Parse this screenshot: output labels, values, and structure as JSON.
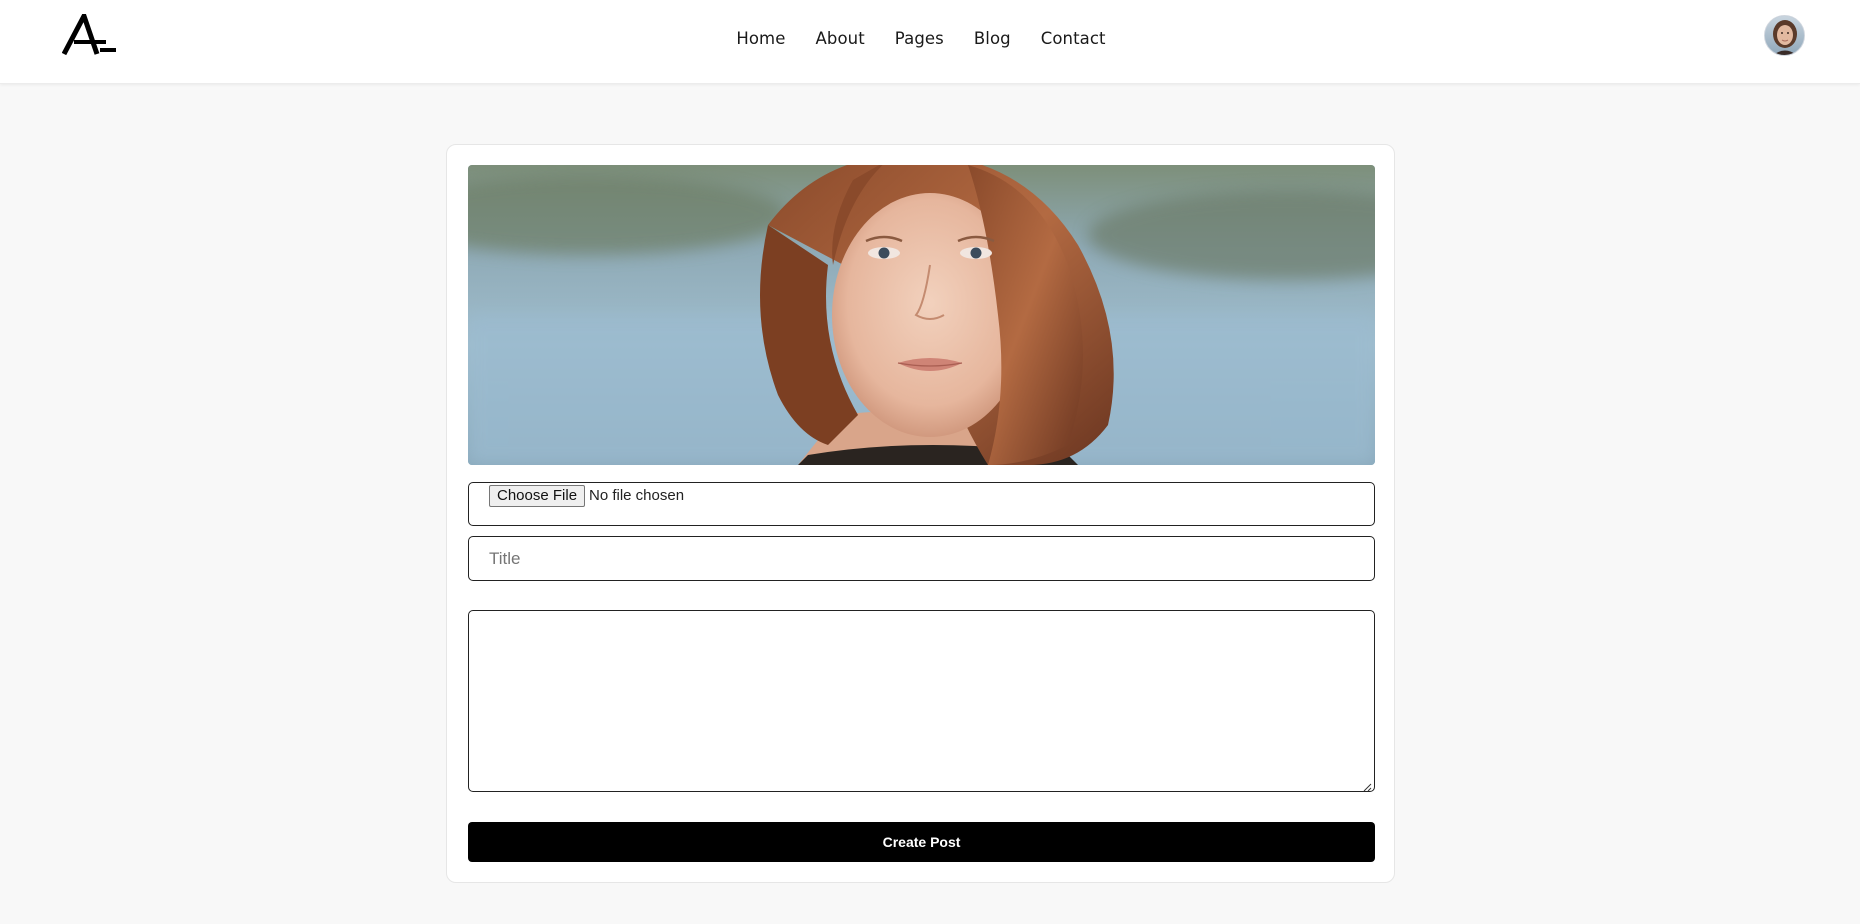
{
  "header": {
    "logo": {
      "icon": "logo-a-icon",
      "name": "A"
    },
    "nav": [
      {
        "label": "Home"
      },
      {
        "label": "About"
      },
      {
        "label": "Pages"
      },
      {
        "label": "Blog"
      },
      {
        "label": "Contact"
      }
    ],
    "avatar": {
      "icon": "user-avatar"
    }
  },
  "form": {
    "preview_image": {
      "subject": "portrait photo preview"
    },
    "file_input": {
      "button_label": "Choose File",
      "status_text": "No file chosen"
    },
    "title_field": {
      "placeholder": "Title",
      "value": ""
    },
    "body_field": {
      "placeholder": "",
      "value": ""
    },
    "submit_label": "Create Post"
  },
  "colors": {
    "page_background": "#f8f8f8",
    "card_background": "#ffffff",
    "button_background": "#000000",
    "button_text": "#ffffff",
    "border": "#222222"
  }
}
